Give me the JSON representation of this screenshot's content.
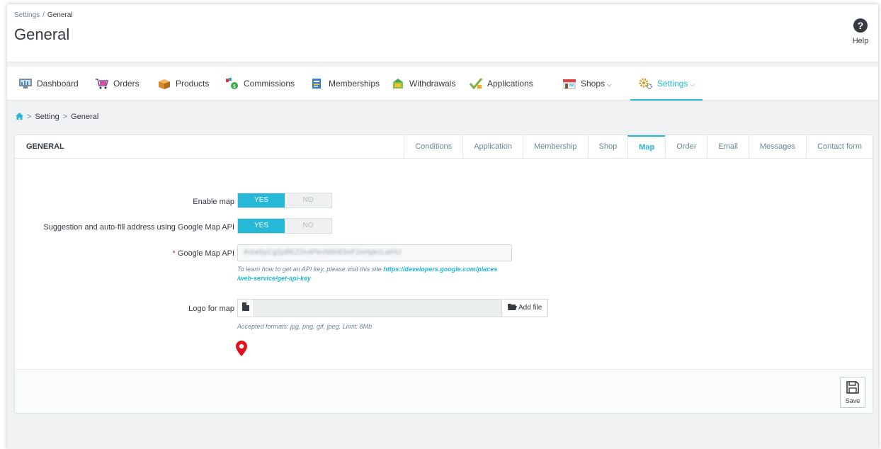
{
  "header": {
    "breadcrumb_parent": "Settings",
    "breadcrumb_sep": "/",
    "breadcrumb_current": "General",
    "title": "General",
    "help_icon": "?",
    "help_label": "Help"
  },
  "nav": {
    "items": [
      {
        "label": "Dashboard",
        "icon": "dashboard-icon"
      },
      {
        "label": "Orders",
        "icon": "cart-icon"
      },
      {
        "label": "Products",
        "icon": "box-icon"
      },
      {
        "label": "Commissions",
        "icon": "money-bag-icon"
      },
      {
        "label": "Memberships",
        "icon": "membership-icon"
      },
      {
        "label": "Withdrawals",
        "icon": "wallet-icon"
      },
      {
        "label": "Applications",
        "icon": "checkmark-icon"
      },
      {
        "label": "Shops",
        "icon": "shop-icon",
        "caret": "⌵"
      },
      {
        "label": "Settings",
        "icon": "gears-icon",
        "caret": "⌵",
        "active": true
      }
    ]
  },
  "breadcrumb2": {
    "home_icon": "home-icon",
    "items": [
      "Setting",
      "General"
    ],
    "sep": ">"
  },
  "panel": {
    "title": "GENERAL",
    "tabs": [
      "Conditions",
      "Application",
      "Membership",
      "Shop",
      "Map",
      "Order",
      "Email",
      "Messages",
      "Contact form"
    ],
    "active_tab": "Map",
    "enable_map_label": "Enable map",
    "suggestion_label": "Suggestion and auto-fill address using Google Map API",
    "switch_yes": "YES",
    "switch_no": "NO",
    "api_required": "*",
    "api_label": "Google Map API",
    "api_value": "AIzaSyCg2pBEZ2n4PknN6hEbxF2oHpkcLwHU",
    "api_hint_prefix": "To learn how to get an API key, please visit this site ",
    "api_hint_link_1": "https://developers.google.com/places",
    "api_hint_link_2": "/web-service/get-api-key",
    "logo_label": "Logo for map",
    "add_file_label": "Add file",
    "formats_hint": "Accepted formats: jpg, png, gif, jpeg. Limit: 8Mb",
    "save_label": "Save"
  },
  "colors": {
    "accent": "#25b9d7",
    "pin": "#e0121f",
    "required": "#e0253a"
  }
}
